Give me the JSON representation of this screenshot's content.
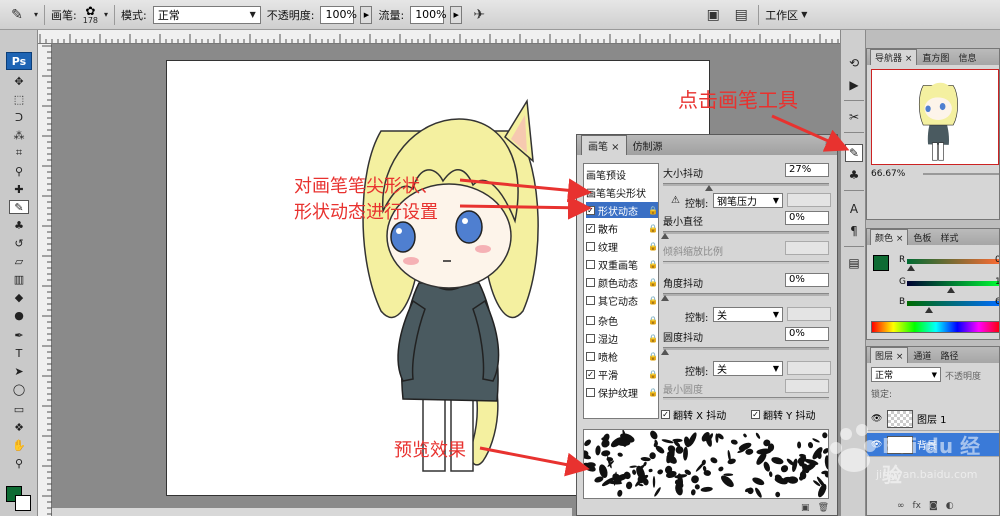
{
  "options_bar": {
    "brush_label": "画笔:",
    "brush_size": "178",
    "mode_label": "模式:",
    "mode_value": "正常",
    "opacity_label": "不透明度:",
    "opacity_value": "100%",
    "flow_label": "流量:",
    "flow_value": "100%",
    "workspace_label": "工作区"
  },
  "toolbox": {
    "logo": "Ps",
    "foreground_color": "#0e6b33",
    "background_color": "#ffffff"
  },
  "brush_panel": {
    "tabs": [
      {
        "label": "画笔"
      },
      {
        "label": "仿制源"
      }
    ],
    "list": [
      {
        "label": "画笔预设",
        "checkbox": false
      },
      {
        "label": "画笔笔尖形状",
        "checkbox": false
      },
      {
        "label": "形状动态",
        "checkbox": true,
        "checked": true,
        "selected": true
      },
      {
        "label": "散布",
        "checkbox": true,
        "checked": true
      },
      {
        "label": "纹理",
        "checkbox": true,
        "checked": false
      },
      {
        "label": "双重画笔",
        "checkbox": true,
        "checked": false
      },
      {
        "label": "颜色动态",
        "checkbox": true,
        "checked": false
      },
      {
        "label": "其它动态",
        "checkbox": true,
        "checked": false
      },
      {
        "label": "杂色",
        "checkbox": true,
        "checked": false
      },
      {
        "label": "湿边",
        "checkbox": true,
        "checked": false
      },
      {
        "label": "喷枪",
        "checkbox": true,
        "checked": false
      },
      {
        "label": "平滑",
        "checkbox": true,
        "checked": true
      },
      {
        "label": "保护纹理",
        "checkbox": true,
        "checked": false
      }
    ],
    "size_jitter_label": "大小抖动",
    "size_jitter_value": "27%",
    "control_label": "控制:",
    "control_pen_value": "钢笔压力",
    "min_diameter_label": "最小直径",
    "min_diameter_value": "0%",
    "tilt_scale_label": "倾斜缩放比例",
    "angle_jitter_label": "角度抖动",
    "angle_jitter_value": "0%",
    "control_angle_value": "关",
    "roundness_jitter_label": "圆度抖动",
    "roundness_jitter_value": "0%",
    "control_round_value": "关",
    "min_roundness_label": "最小圆度",
    "flip_x_label": "翻转 X 抖动",
    "flip_y_label": "翻转 Y 抖动"
  },
  "right_panels": {
    "navigator_tabs": [
      {
        "label": "导航器"
      },
      {
        "label": "直方图"
      },
      {
        "label": "信息"
      }
    ],
    "zoom_value": "66.67%",
    "color_tabs": [
      {
        "label": "颜色"
      },
      {
        "label": "色板"
      },
      {
        "label": "样式"
      }
    ],
    "color_r": "R",
    "color_g": "G",
    "color_b": "B",
    "color_r_value": "0",
    "color_g_value": "1",
    "color_b_value": "6",
    "layers_tabs": [
      {
        "label": "图层"
      },
      {
        "label": "通道"
      },
      {
        "label": "路径"
      }
    ],
    "layer_mode": "正常",
    "layer_opacity_label": "不透明度",
    "lock_label": "锁定:",
    "layers": [
      {
        "name": "图层 1"
      },
      {
        "name": "背景"
      }
    ]
  },
  "annotations": {
    "click_brush_tool": "点击画笔工具",
    "brush_tip_line1": "对画笔笔尖形状、",
    "brush_tip_line2": "形状动态进行设置",
    "preview": "预览效果"
  },
  "watermark": {
    "brand": "Bai du 经验",
    "url": "jingyan.baidu.com"
  }
}
